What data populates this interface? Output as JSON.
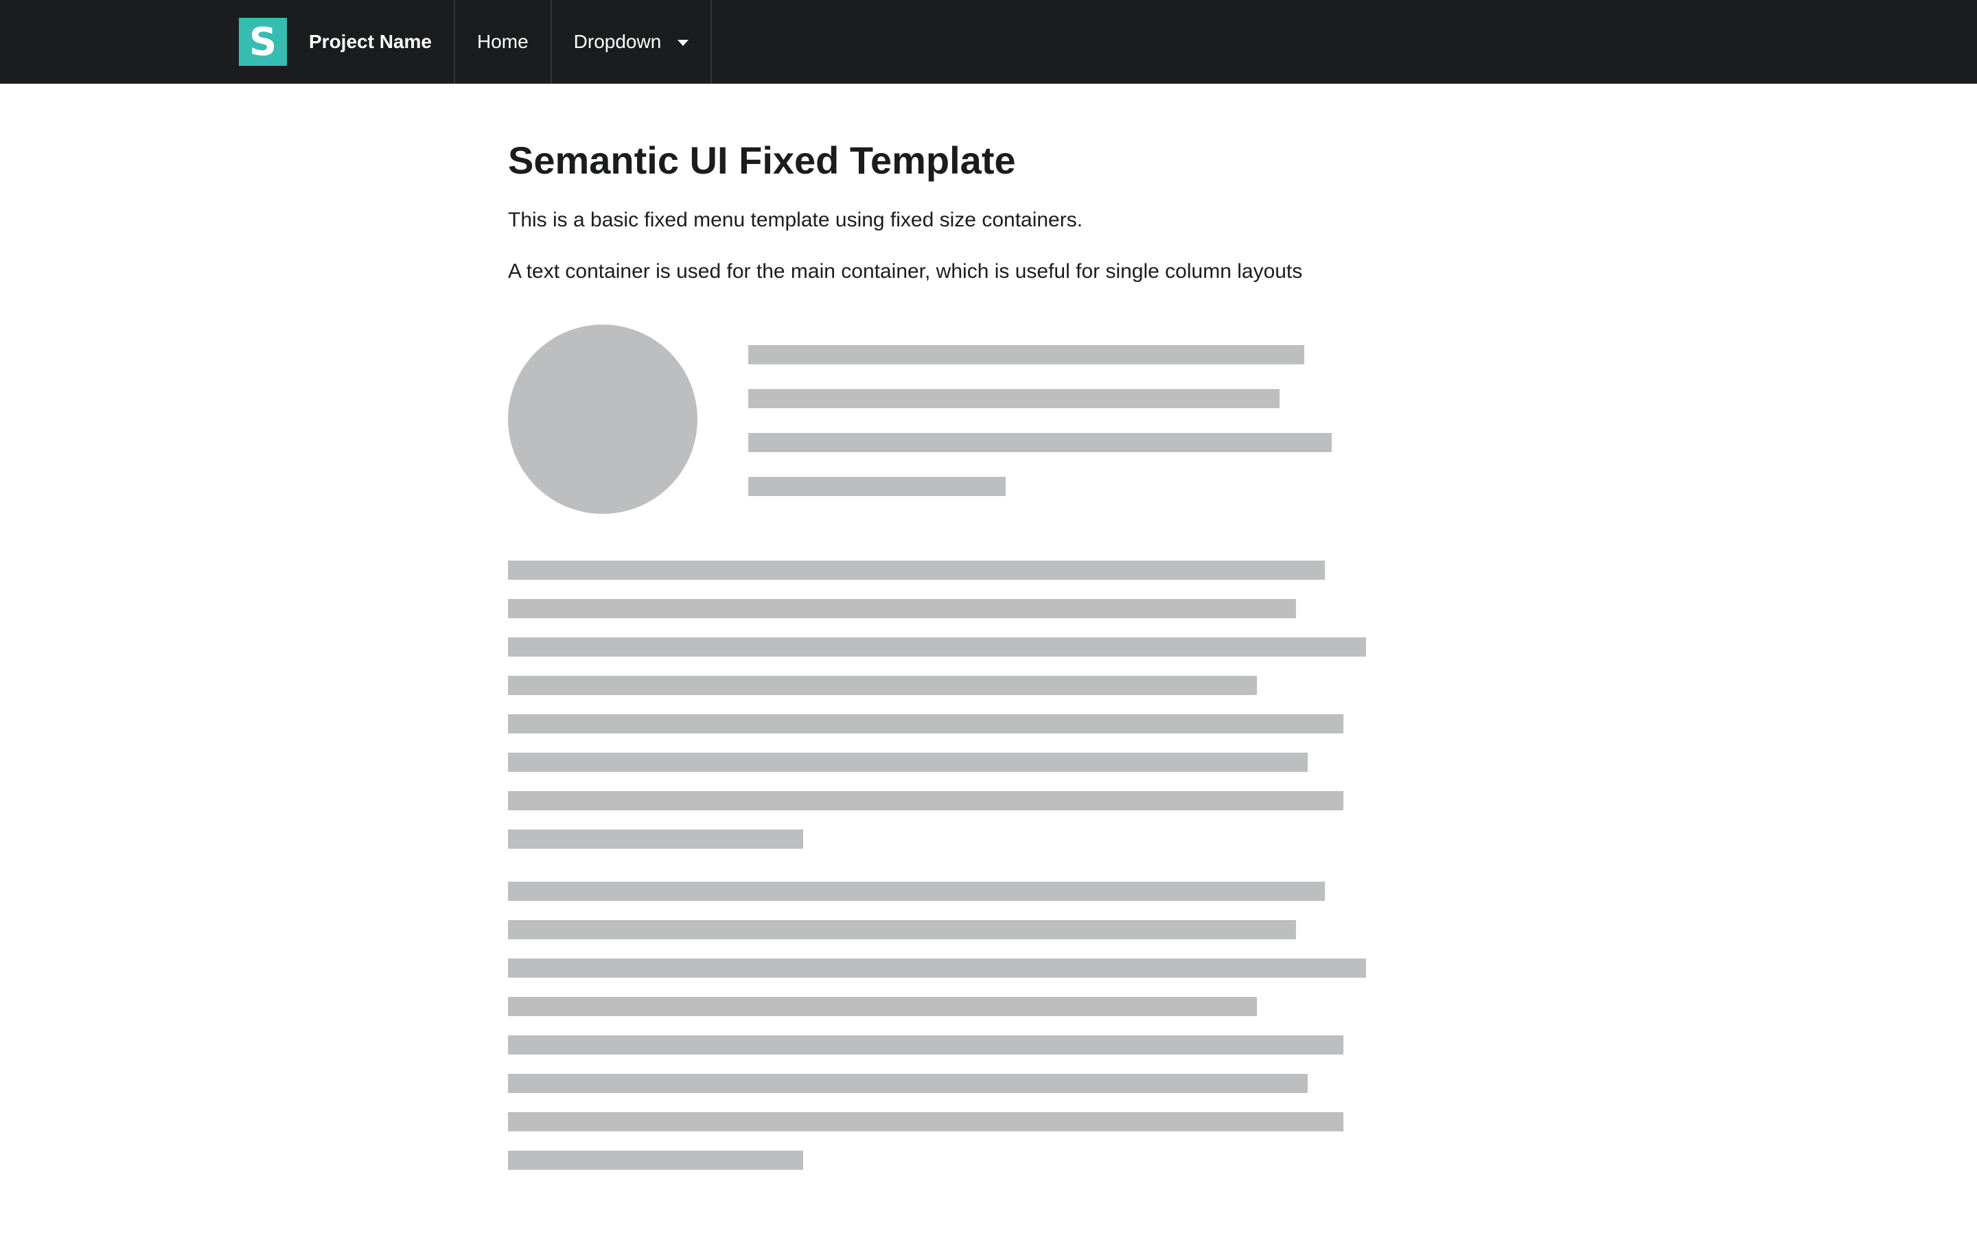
{
  "nav": {
    "logo_letter": "S",
    "brand": "Project Name",
    "items": [
      {
        "label": "Home"
      },
      {
        "label": "Dropdown"
      }
    ]
  },
  "main": {
    "title": "Semantic UI Fixed Template",
    "intro": "This is a basic fixed menu template using fixed size containers.",
    "intro2": "A text container is used for the main container, which is useful for single column layouts"
  },
  "colors": {
    "topbar_bg": "#1b1c1d",
    "logo_bg": "#35bdb2",
    "placeholder": "#bdbebf"
  }
}
